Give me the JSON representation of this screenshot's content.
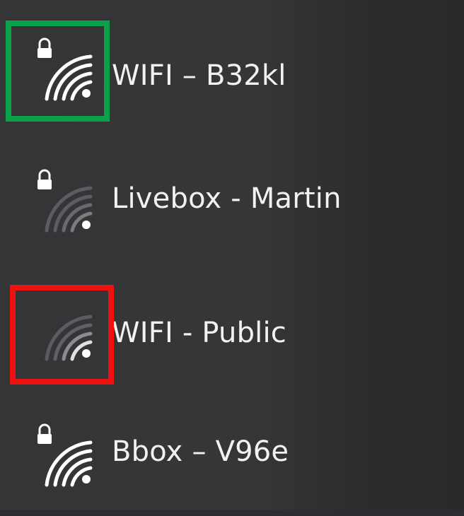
{
  "networks": [
    {
      "name": "WIFI – B32kl",
      "secured": true,
      "signal": "full",
      "highlight": "#0aa14a"
    },
    {
      "name": "Livebox - Martin",
      "secured": true,
      "signal": "low",
      "highlight": null
    },
    {
      "name": "WIFI - Public",
      "secured": false,
      "signal": "low",
      "highlight": "#ee1111"
    },
    {
      "name": "Bbox – V96e",
      "secured": true,
      "signal": "full",
      "highlight": null
    }
  ],
  "icons": {
    "lock": "lock-icon",
    "wifi": "wifi-signal-icon"
  }
}
